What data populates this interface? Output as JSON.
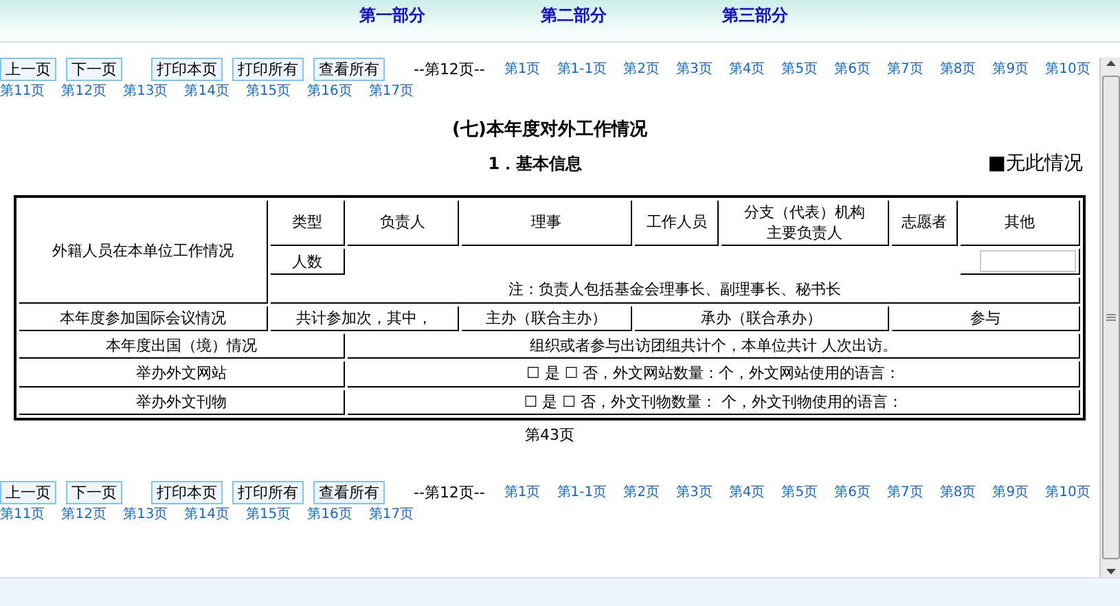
{
  "top_nav": [
    {
      "label": "第一部分"
    },
    {
      "label": "第二部分"
    },
    {
      "label": "第三部分"
    }
  ],
  "pagers": [
    {
      "buttons": [
        "上一页",
        "下一页",
        "打印本页",
        "打印所有",
        "查看所有"
      ],
      "current": "--第12页--",
      "links": [
        "第1页",
        "第1-1页",
        "第2页",
        "第3页",
        "第4页",
        "第5页",
        "第6页",
        "第7页",
        "第8页",
        "第9页",
        "第10页",
        "第11页",
        "第12页",
        "第13页",
        "第14页",
        "第15页",
        "第16页",
        "第17页"
      ]
    },
    {
      "buttons": [
        "上一页",
        "下一页",
        "打印本页",
        "打印所有",
        "查看所有"
      ],
      "current": "--第12页--",
      "links": [
        "第1页",
        "第1-1页",
        "第2页",
        "第3页",
        "第4页",
        "第5页",
        "第6页",
        "第7页",
        "第8页",
        "第9页",
        "第10页",
        "第11页",
        "第12页",
        "第13页",
        "第14页",
        "第15页",
        "第16页",
        "第17页"
      ]
    }
  ],
  "title": "(七)本年度对外工作情况",
  "subtitle": "1．基本信息",
  "no_case": "■无此情况",
  "table": {
    "staff": {
      "label": "外籍人员在本单位工作情况",
      "type_label": "类型",
      "columns": [
        {
          "lines": [
            "负责人"
          ]
        },
        {
          "lines": [
            "理事"
          ]
        },
        {
          "lines": [
            "工作人员"
          ]
        },
        {
          "lines": [
            "分支（代表）机构",
            "主要负责人"
          ]
        },
        {
          "lines": [
            "志愿者"
          ]
        },
        {
          "lines": [
            "其他"
          ]
        }
      ],
      "count_label": "人数",
      "note": "注：负责人包括基金会理事长、副理事长、秘书长"
    },
    "meetings": {
      "label": "本年度参加国际会议情况",
      "cells": [
        "共计参加次，其中，",
        "主办（联合主办）",
        "承办（联合承办）",
        "参与"
      ]
    },
    "rows": [
      {
        "label": "本年度出国（境）情况",
        "text": "组织或者参与出访团组共计个，本单位共计 人次出访。"
      },
      {
        "label": "举办外文网站",
        "text": "☐ 是 ☐ 否，外文网站数量：个，外文网站使用的语言："
      },
      {
        "label": "举办外文刊物",
        "text": "☐ 是 ☐ 否，外文刊物数量： 个，外文刊物使用的语言："
      }
    ]
  },
  "page_number": "第43页"
}
